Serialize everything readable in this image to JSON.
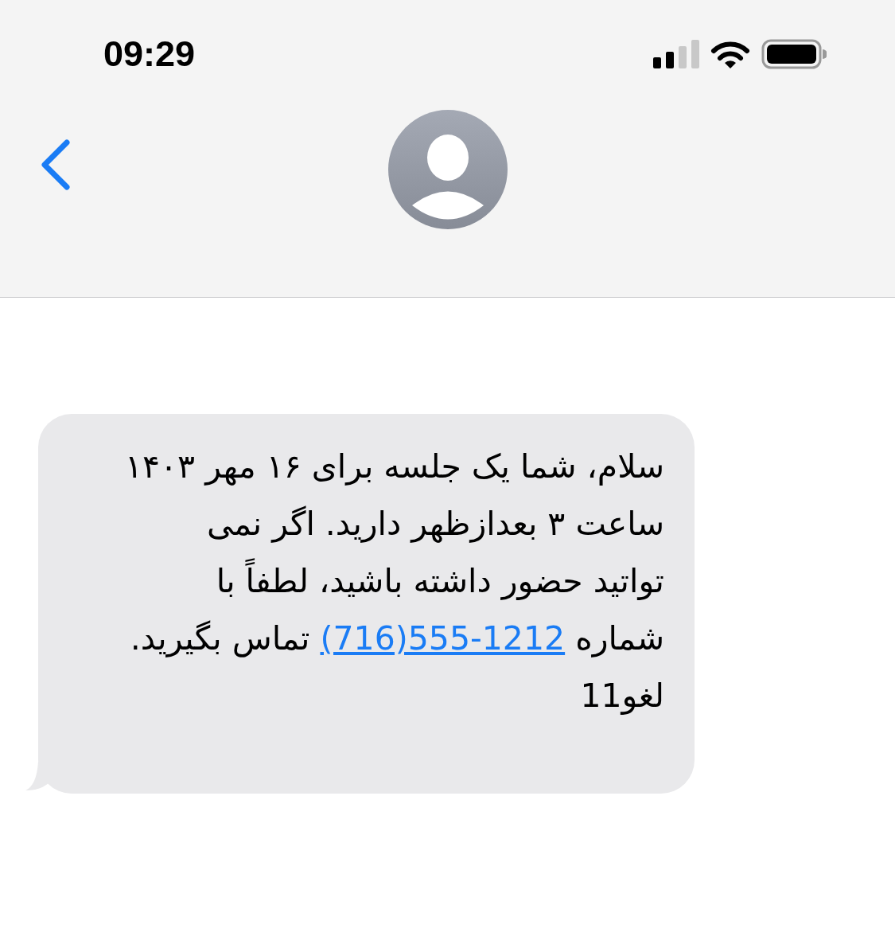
{
  "status_bar": {
    "time": "09:29"
  },
  "messages": [
    {
      "kind": "incoming",
      "text_before": "سلام، شما یک جلسه برای ۱۶ مهر ۱۴۰۳\nساعت ۳ بعدازظهر دارید. اگر نمی\nتواتید حضور داشته باشید، لطفاً با\nشماره ",
      "link": "(716)555-1212",
      "text_after": " تماس بگیرید.\nلغو11"
    }
  ]
}
